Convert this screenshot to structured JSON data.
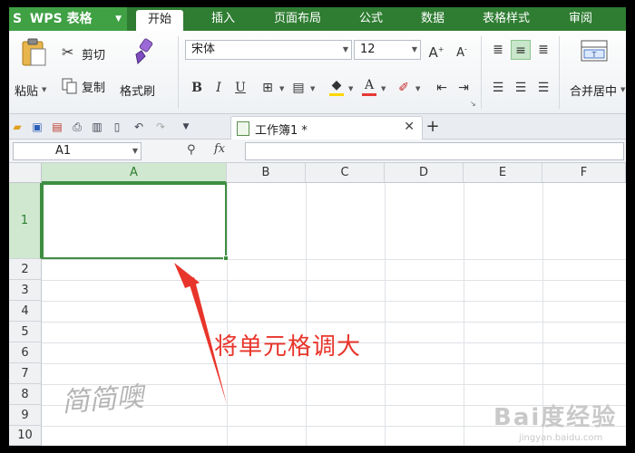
{
  "app": {
    "name": "WPS 表格",
    "logo_glyph": "S"
  },
  "menu": {
    "tabs": [
      {
        "label": "开始",
        "active": true
      },
      {
        "label": "插入"
      },
      {
        "label": "页面布局"
      },
      {
        "label": "公式"
      },
      {
        "label": "数据"
      },
      {
        "label": "表格样式"
      },
      {
        "label": "审阅"
      }
    ]
  },
  "ribbon": {
    "paste_label": "粘贴",
    "cut_label": "剪切",
    "copy_label": "复制",
    "format_painter_label": "格式刷",
    "font_name": "宋体",
    "font_size": "12",
    "bold": "B",
    "italic": "I",
    "underline": "U",
    "merge_center_label": "合并居中"
  },
  "document": {
    "tab_title": "工作簿1 *"
  },
  "formula_bar": {
    "name_box": "A1",
    "fx_label": "fx",
    "formula": ""
  },
  "grid": {
    "columns": [
      "A",
      "B",
      "C",
      "D",
      "E",
      "F"
    ],
    "rows": [
      "1",
      "2",
      "3",
      "4",
      "5",
      "6",
      "7",
      "8",
      "9",
      "10"
    ],
    "active_cell": "A1"
  },
  "annotation": {
    "text": "将单元格调大",
    "watermark": "简简噢",
    "baidu_logo": "Bai度经验",
    "baidu_url": "jingyan.baidu.com"
  },
  "colors": {
    "menu_bg": "#2f7d32",
    "accent": "#3e8e41",
    "annotation": "#e8352b"
  }
}
